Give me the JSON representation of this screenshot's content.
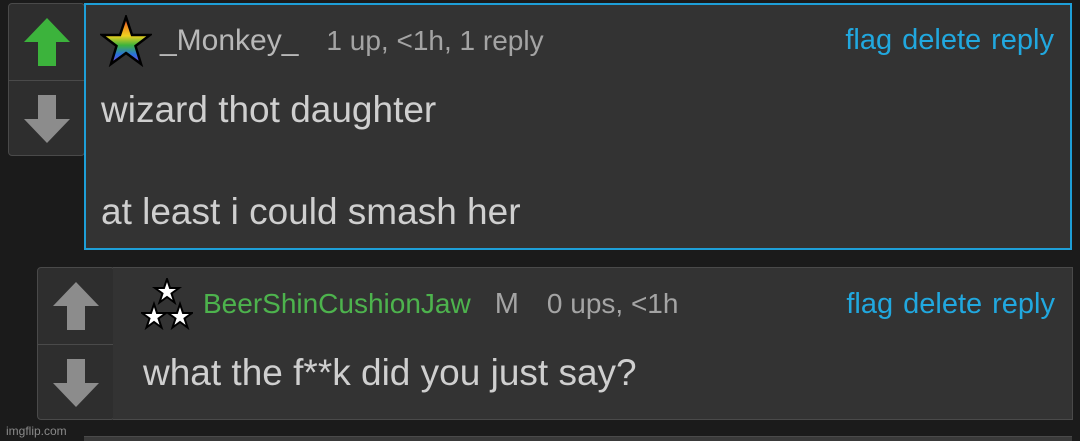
{
  "comments": [
    {
      "username": "_Monkey_",
      "meta": "1 up, <1h, 1 reply",
      "actions": {
        "flag": "flag",
        "delete": "delete",
        "reply": "reply"
      },
      "body_lines": [
        "wizard thot daughter",
        "at least i could smash her"
      ],
      "upvoted": true,
      "badge_icon": "rainbow-star-icon"
    },
    {
      "username": "BeerShinCushionJaw",
      "mod_badge": "M",
      "meta": "0 ups, <1h",
      "actions": {
        "flag": "flag",
        "delete": "delete",
        "reply": "reply"
      },
      "body_lines": [
        "what the f**k did you just say?"
      ],
      "upvoted": false,
      "badge_icon": "three-stars-icon"
    }
  ],
  "watermark": "imgflip.com",
  "colors": {
    "accent_link": "#21a8df",
    "selected_border": "#1e9fd8",
    "upvote_active": "#3cb33c",
    "vote_inactive": "#8c8c8c",
    "reply_accent": "#f58a0b",
    "username_green": "#4db34d"
  }
}
